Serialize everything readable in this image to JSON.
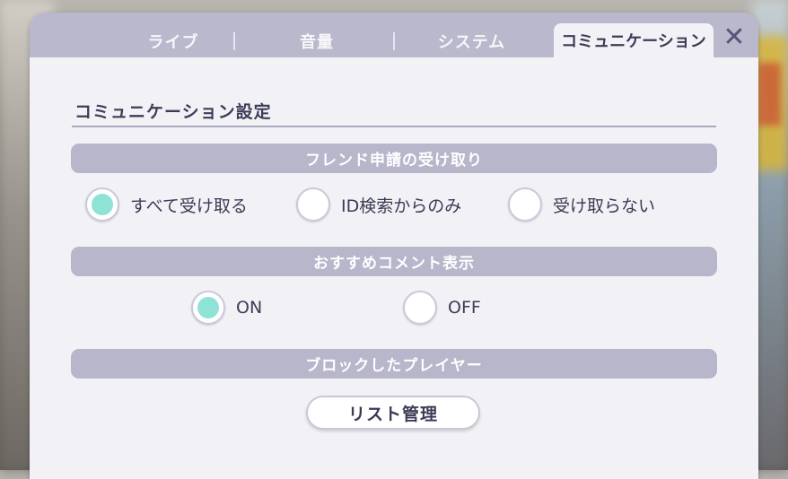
{
  "tabs": [
    {
      "label": "ライブ"
    },
    {
      "label": "音量"
    },
    {
      "label": "システム"
    },
    {
      "label": "コミュニケーション"
    }
  ],
  "close_icon": "close-icon",
  "section_title": "コミュニケーション設定",
  "friend_request": {
    "header": "フレンド申請の受け取り",
    "options": [
      {
        "label": "すべて受け取る",
        "selected": true
      },
      {
        "label": "ID検索からのみ",
        "selected": false
      },
      {
        "label": "受け取らない",
        "selected": false
      }
    ]
  },
  "recommend_comment": {
    "header": "おすすめコメント表示",
    "options": [
      {
        "label": "ON",
        "selected": true
      },
      {
        "label": "OFF",
        "selected": false
      }
    ]
  },
  "blocked_players": {
    "header": "ブロックしたプレイヤー",
    "button_label": "リスト管理"
  },
  "colors": {
    "accent": "#8ee2d6",
    "tab_bar": "#b9b8cc",
    "panel": "#f2f2f6",
    "text_dark": "#3b3b55"
  }
}
